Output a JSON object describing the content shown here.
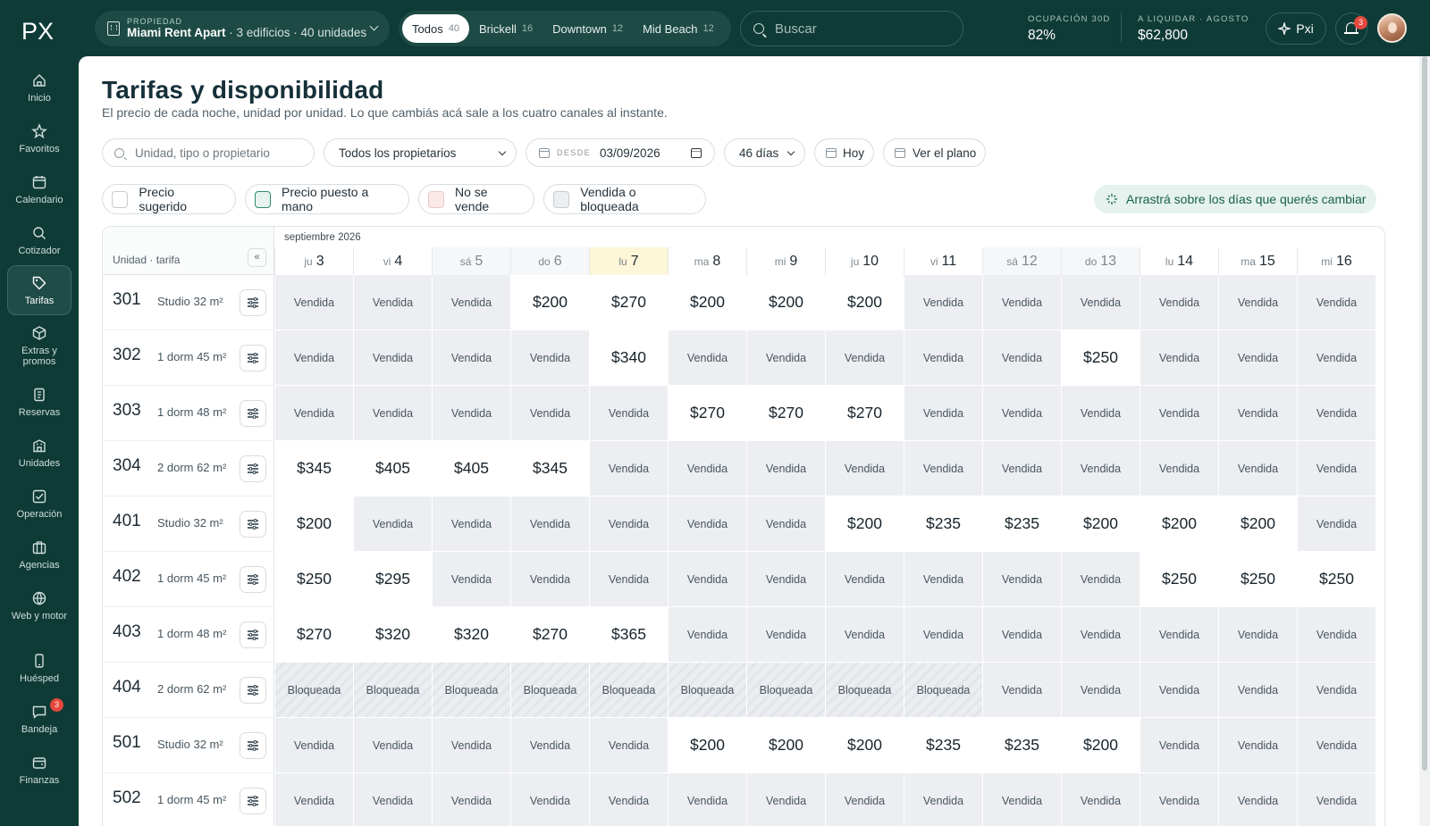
{
  "brand": {
    "logo_text": "PX"
  },
  "header": {
    "property_eyebrow": "PROPIEDAD",
    "property_name": "Miami Rent Apart",
    "property_detail": " · 3 edificios · 40 unidades",
    "segments": [
      {
        "label": "Todos",
        "count": "40",
        "active": true
      },
      {
        "label": "Brickell",
        "count": "16",
        "active": false
      },
      {
        "label": "Downtown",
        "count": "12",
        "active": false
      },
      {
        "label": "Mid Beach",
        "count": "12",
        "active": false
      }
    ],
    "search_placeholder": "Buscar",
    "kpis": [
      {
        "label": "OCUPACIÓN 30D",
        "value": "82%"
      },
      {
        "label": "A LIQUIDAR · AGOSTO",
        "value": "$62,800"
      }
    ],
    "pxi_label": "Pxi",
    "notifications_count": "3"
  },
  "sidebar": {
    "items": [
      {
        "label": "Inicio",
        "icon": "home-icon"
      },
      {
        "label": "Favoritos",
        "icon": "star-icon"
      },
      {
        "label": "Calendario",
        "icon": "calendar-icon"
      },
      {
        "label": "Cotizador",
        "icon": "search-icon"
      },
      {
        "label": "Tarifas",
        "icon": "tag-icon",
        "active": true
      },
      {
        "label": "Extras y promos",
        "icon": "gift-icon"
      },
      {
        "label": "Reservas",
        "icon": "receipt-icon"
      },
      {
        "label": "Unidades",
        "icon": "building-icon"
      },
      {
        "label": "Operación",
        "icon": "checkbox-icon"
      },
      {
        "label": "Agencias",
        "icon": "briefcase-icon"
      },
      {
        "label": "Web y motor",
        "icon": "globe-icon"
      },
      {
        "label": "Huésped",
        "icon": "phone-icon"
      },
      {
        "label": "Bandeja",
        "icon": "chat-icon",
        "badge": "3"
      },
      {
        "label": "Finanzas",
        "icon": "wallet-icon"
      }
    ]
  },
  "page": {
    "title": "Tarifas y disponibilidad",
    "subtitle": "El precio de cada noche, unidad por unidad. Lo que cambiás acá sale a los cuatro canales al instante."
  },
  "filters": {
    "unit_search_placeholder": "Unidad, tipo o propietario",
    "owner_select": "Todos los propietarios",
    "from_label": "DESDE",
    "from_date": "03/09/2026",
    "range_select": "46 días",
    "today_label": "Hoy",
    "plan_label": "Ver el plano"
  },
  "legend": [
    {
      "label": "Precio sugerido",
      "color": "#ffffff",
      "border": "#c6ccd0"
    },
    {
      "label": "Precio puesto a mano",
      "color": "#e6f3ef",
      "border": "#2f8a73"
    },
    {
      "label": "No se vende",
      "color": "#fbe9ea",
      "border": "#e9c7ca"
    },
    {
      "label": "Vendida o bloqueada",
      "color": "#eceef2",
      "border": "#c6ccd0"
    }
  ],
  "hint": "Arrastrá sobre los días que querés cambiar",
  "grid": {
    "unit_header": "Unidad · tarifa",
    "collapse_label": "«",
    "month": "septiembre 2026",
    "days": [
      {
        "dow": "ju",
        "num": "3",
        "kind": "normal"
      },
      {
        "dow": "vi",
        "num": "4",
        "kind": "normal"
      },
      {
        "dow": "sá",
        "num": "5",
        "kind": "weekend"
      },
      {
        "dow": "do",
        "num": "6",
        "kind": "weekend"
      },
      {
        "dow": "lu",
        "num": "7",
        "kind": "today"
      },
      {
        "dow": "ma",
        "num": "8",
        "kind": "normal"
      },
      {
        "dow": "mi",
        "num": "9",
        "kind": "normal"
      },
      {
        "dow": "ju",
        "num": "10",
        "kind": "normal"
      },
      {
        "dow": "vi",
        "num": "11",
        "kind": "normal"
      },
      {
        "dow": "sá",
        "num": "12",
        "kind": "weekend"
      },
      {
        "dow": "do",
        "num": "13",
        "kind": "weekend"
      },
      {
        "dow": "lu",
        "num": "14",
        "kind": "normal"
      },
      {
        "dow": "ma",
        "num": "15",
        "kind": "normal"
      },
      {
        "dow": "mi",
        "num": "16",
        "kind": "normal"
      }
    ],
    "rows": [
      {
        "unit": "301",
        "type": "Studio 32 m²",
        "cells": [
          "Vendida",
          "Vendida",
          "Vendida",
          "$200",
          "$270",
          "$200",
          "$200",
          "$200",
          "Vendida",
          "Vendida",
          "Vendida",
          "Vendida",
          "Vendida",
          "Vendida"
        ]
      },
      {
        "unit": "302",
        "type": "1 dorm 45 m²",
        "cells": [
          "Vendida",
          "Vendida",
          "Vendida",
          "Vendida",
          "$340",
          "Vendida",
          "Vendida",
          "Vendida",
          "Vendida",
          "Vendida",
          "$250",
          "Vendida",
          "Vendida",
          "Vendida"
        ]
      },
      {
        "unit": "303",
        "type": "1 dorm 48 m²",
        "cells": [
          "Vendida",
          "Vendida",
          "Vendida",
          "Vendida",
          "Vendida",
          "$270",
          "$270",
          "$270",
          "Vendida",
          "Vendida",
          "Vendida",
          "Vendida",
          "Vendida",
          "Vendida"
        ]
      },
      {
        "unit": "304",
        "type": "2 dorm 62 m²",
        "cells": [
          "$345",
          "$405",
          "$405",
          "$345",
          "Vendida",
          "Vendida",
          "Vendida",
          "Vendida",
          "Vendida",
          "Vendida",
          "Vendida",
          "Vendida",
          "Vendida",
          "Vendida"
        ]
      },
      {
        "unit": "401",
        "type": "Studio 32 m²",
        "cells": [
          "$200",
          "Vendida",
          "Vendida",
          "Vendida",
          "Vendida",
          "Vendida",
          "Vendida",
          "$200",
          "$235",
          "$235",
          "$200",
          "$200",
          "$200",
          "Vendida"
        ]
      },
      {
        "unit": "402",
        "type": "1 dorm 45 m²",
        "cells": [
          "$250",
          "$295",
          "Vendida",
          "Vendida",
          "Vendida",
          "Vendida",
          "Vendida",
          "Vendida",
          "Vendida",
          "Vendida",
          "Vendida",
          "$250",
          "$250",
          "$250"
        ]
      },
      {
        "unit": "403",
        "type": "1 dorm 48 m²",
        "cells": [
          "$270",
          "$320",
          "$320",
          "$270",
          "$365",
          "Vendida",
          "Vendida",
          "Vendida",
          "Vendida",
          "Vendida",
          "Vendida",
          "Vendida",
          "Vendida",
          "Vendida"
        ]
      },
      {
        "unit": "404",
        "type": "2 dorm 62 m²",
        "cells": [
          "Bloqueada",
          "Bloqueada",
          "Bloqueada",
          "Bloqueada",
          "Bloqueada",
          "Bloqueada",
          "Bloqueada",
          "Bloqueada",
          "Bloqueada",
          "Vendida",
          "Vendida",
          "Vendida",
          "Vendida",
          "Vendida"
        ]
      },
      {
        "unit": "501",
        "type": "Studio 32 m²",
        "cells": [
          "Vendida",
          "Vendida",
          "Vendida",
          "Vendida",
          "Vendida",
          "$200",
          "$200",
          "$200",
          "$235",
          "$235",
          "$200",
          "Vendida",
          "Vendida",
          "Vendida"
        ]
      },
      {
        "unit": "502",
        "type": "1 dorm 45 m²",
        "cells": [
          "Vendida",
          "Vendida",
          "Vendida",
          "Vendida",
          "Vendida",
          "Vendida",
          "Vendida",
          "Vendida",
          "Vendida",
          "Vendida",
          "Vendida",
          "Vendida",
          "Vendida",
          "Vendida"
        ]
      }
    ]
  }
}
